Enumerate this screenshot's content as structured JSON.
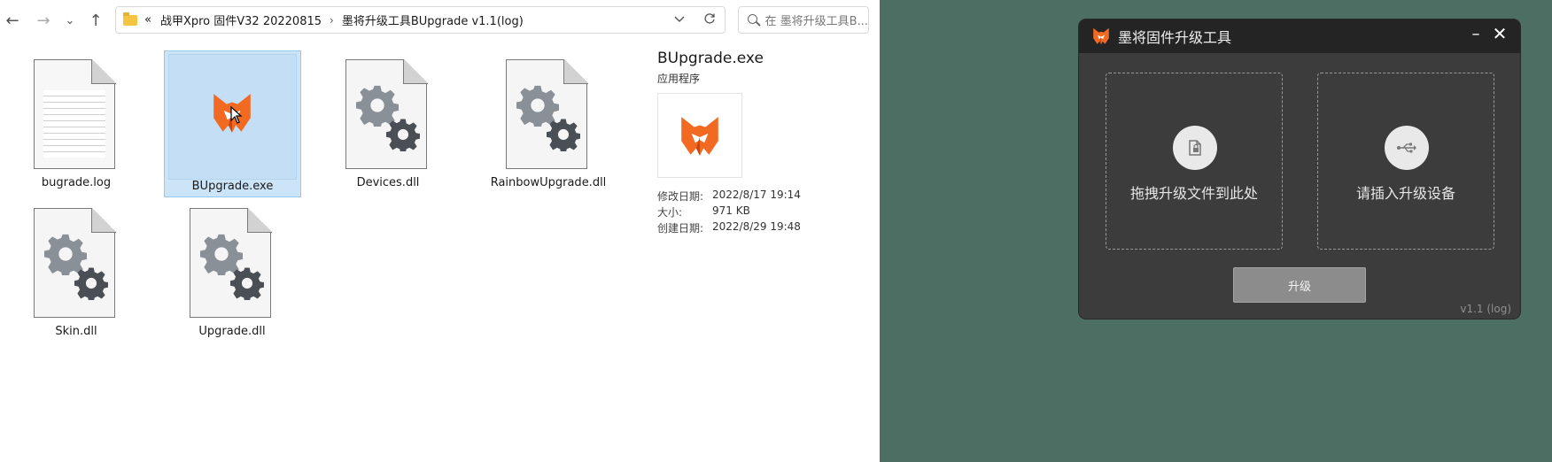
{
  "explorer": {
    "nav": {
      "back": "←",
      "forward": "→",
      "recent": "⌄",
      "up": "↑"
    },
    "address": {
      "lead": "«",
      "crumbs": [
        "战甲Xpro 固件V32 20220815",
        "墨将升级工具BUpgrade v1.1(log)"
      ],
      "separator": "›"
    },
    "search": {
      "placeholder": "在 墨将升级工具B..."
    },
    "files": [
      {
        "name": "bugrade.log",
        "icon": "text-document-icon"
      },
      {
        "name": "BUpgrade.exe",
        "icon": "mojiang-logo-icon",
        "selected": true
      },
      {
        "name": "Devices.dll",
        "icon": "dll-gear-icon"
      },
      {
        "name": "RainbowUpgrade.dll",
        "icon": "dll-gear-icon"
      },
      {
        "name": "Skin.dll",
        "icon": "dll-gear-icon"
      },
      {
        "name": "Upgrade.dll",
        "icon": "dll-gear-icon"
      }
    ],
    "preview": {
      "title": "BUpgrade.exe",
      "type": "应用程序",
      "props": [
        {
          "key": "修改日期:",
          "value": "2022/8/17 19:14"
        },
        {
          "key": "大小:",
          "value": "971 KB"
        },
        {
          "key": "创建日期:",
          "value": "2022/8/29 19:48"
        }
      ]
    }
  },
  "tool": {
    "title": "墨将固件升级工具",
    "minimize": "–",
    "close": "✕",
    "drop_file_label": "拖拽升级文件到此处",
    "device_label": "请插入升级设备",
    "upgrade_button": "升级",
    "version": "v1.1 (log)"
  },
  "colors": {
    "brand_orange": "#f26a21",
    "selection_bg": "#cce4f7",
    "desktop_bg": "#4d6e63",
    "tool_bg": "#3c3c3c",
    "tool_titlebar": "#242424"
  }
}
